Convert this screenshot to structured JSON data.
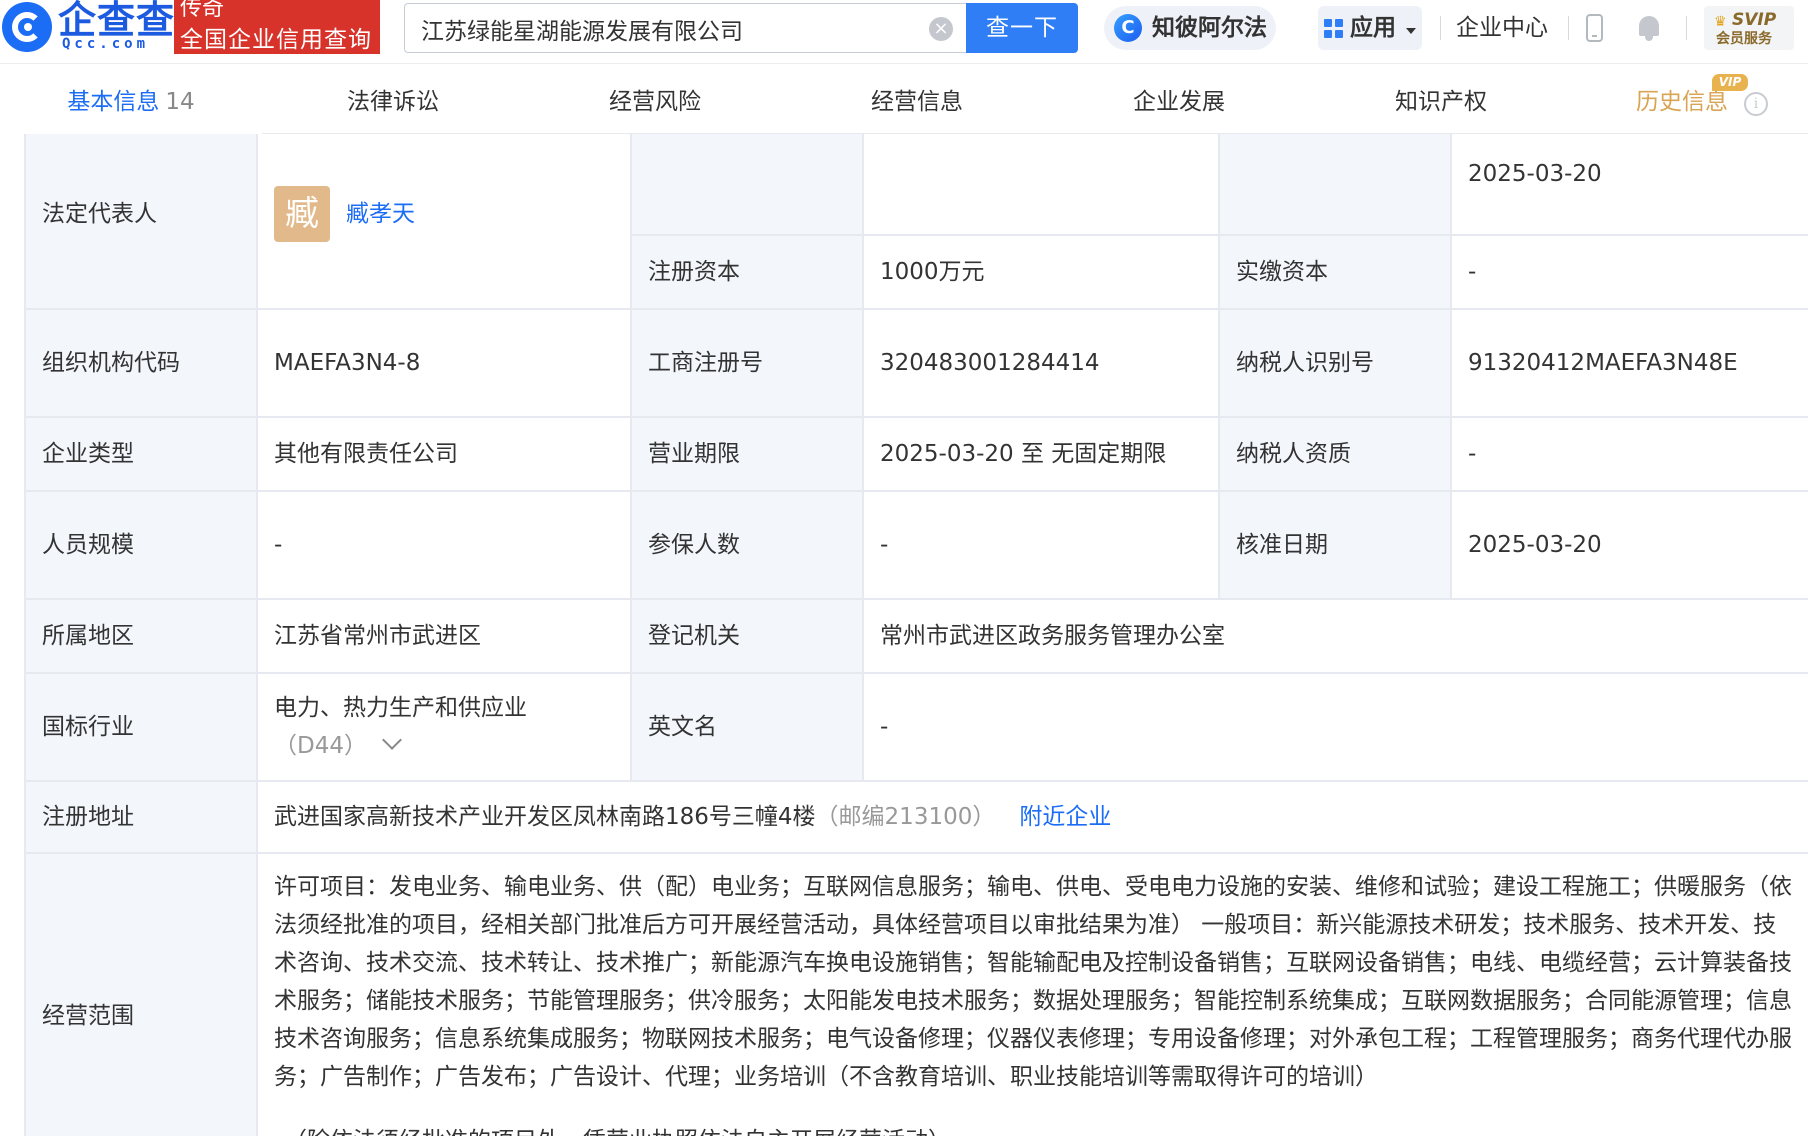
{
  "header": {
    "logo_cn": "企查查",
    "logo_en": "Qcc.com",
    "badge_line1": "传奇",
    "badge_line2": "全国企业信用查询",
    "search_value": "江苏绿能星湖能源发展有限公司",
    "search_button": "查一下",
    "zhibi_label": "知彼阿尔法",
    "app_label": "应用",
    "enterprise_center": "企业中心",
    "svip_title": "SVIP",
    "svip_sub": "会员服务"
  },
  "tabs": [
    {
      "label": "基本信息",
      "count": "14"
    },
    {
      "label": "法律诉讼"
    },
    {
      "label": "经营风险"
    },
    {
      "label": "经营信息"
    },
    {
      "label": "企业发展"
    },
    {
      "label": "知识产权"
    },
    {
      "label": "历史信息",
      "tag": "VIP"
    }
  ],
  "info": {
    "legal_rep_label": "法定代表人",
    "legal_rep_avatar": "臧",
    "legal_rep_name": "臧孝天",
    "partial_date": "2025-03-20",
    "reg_capital_label": "注册资本",
    "reg_capital_value": "1000万元",
    "paid_capital_label": "实缴资本",
    "paid_capital_value": "-",
    "org_code_label": "组织机构代码",
    "org_code_value": "MAEFA3N4-8",
    "biz_reg_no_label": "工商注册号",
    "biz_reg_no_value": "320483001284414",
    "taxpayer_id_label": "纳税人识别号",
    "taxpayer_id_value": "91320412MAEFA3N48E",
    "company_type_label": "企业类型",
    "company_type_value": "其他有限责任公司",
    "biz_term_label": "营业期限",
    "biz_term_value": "2025-03-20 至 无固定期限",
    "taxpayer_qual_label": "纳税人资质",
    "taxpayer_qual_value": "-",
    "staff_size_label": "人员规模",
    "staff_size_value": "-",
    "insured_label": "参保人数",
    "insured_value": "-",
    "approval_date_label": "核准日期",
    "approval_date_value": "2025-03-20",
    "region_label": "所属地区",
    "region_value": "江苏省常州市武进区",
    "reg_authority_label": "登记机关",
    "reg_authority_value": "常州市武进区政务服务管理办公室",
    "industry_label": "国标行业",
    "industry_value": "电力、热力生产和供应业",
    "industry_code": "（D44）",
    "english_name_label": "英文名",
    "english_name_value": "-",
    "reg_address_label": "注册地址",
    "reg_address_value": "武进国家高新技术产业开发区凤林南路186号三幢4楼",
    "postcode": "（邮编213100）",
    "nearby_link": "附近企业",
    "scope_label": "经营范围",
    "scope_text": "许可项目：发电业务、输电业务、供（配）电业务；互联网信息服务；输电、供电、受电电力设施的安装、维修和试验；建设工程施工；供暖服务（依法须经批准的项目，经相关部门批准后方可开展经营活动，具体经营项目以审批结果为准） 一般项目：新兴能源技术研发；技术服务、技术开发、技术咨询、技术交流、技术转让、技术推广；新能源汽车换电设施销售；智能输配电及控制设备销售；互联网设备销售；电线、电缆经营；云计算装备技术服务；储能技术服务；节能管理服务；供冷服务；太阳能发电技术服务；数据处理服务；智能控制系统集成；互联网数据服务；合同能源管理；信息技术咨询服务；信息系统集成服务；物联网技术服务；电气设备修理；仪器仪表修理；专用设备修理；对外承包工程；工程管理服务；商务代理代办服务；广告制作；广告发布；广告设计、代理；业务培训（不含教育培训、职业技能培训等需取得许可的培训）",
    "scope_note": "（除依法须经批准的项目外，凭营业执照依法自主开展经营活动）"
  }
}
